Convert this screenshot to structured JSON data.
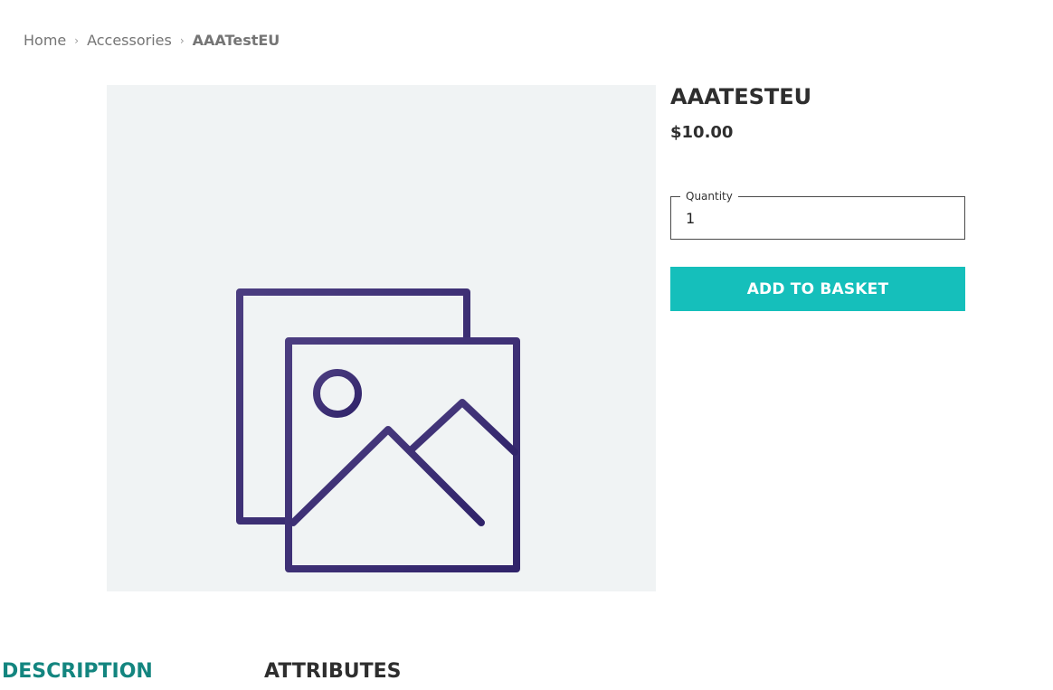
{
  "breadcrumb": {
    "home": "Home",
    "category": "Accessories",
    "current": "AAATestEU",
    "separator": "›"
  },
  "product": {
    "title": "AAATESTEU",
    "price": "$10.00",
    "image_icon": "image-placeholder-icon"
  },
  "quantity": {
    "label": "Quantity",
    "value": "1"
  },
  "actions": {
    "add_to_basket": "ADD TO BASKET"
  },
  "tabs": [
    {
      "label": "DESCRIPTION",
      "active": true
    },
    {
      "label": "ATTRIBUTES",
      "active": false
    }
  ],
  "colors": {
    "accent_button": "#15bfbb",
    "active_tab": "#13857f",
    "image_background": "#f0f3f4",
    "icon_gradient_start": "#4b3d80",
    "icon_gradient_end": "#30236a"
  }
}
